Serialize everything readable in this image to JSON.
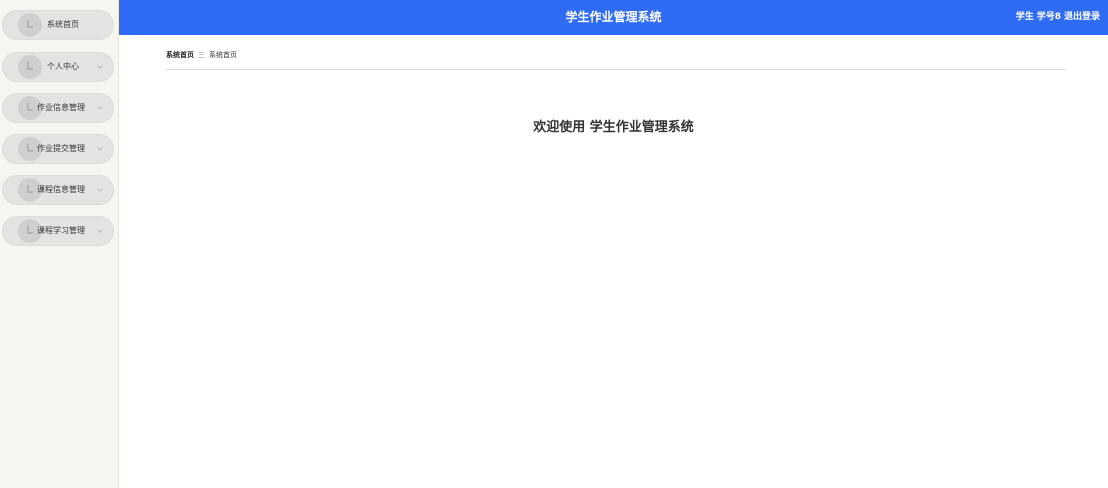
{
  "header": {
    "title": "学生作业管理系统",
    "user_role": "学生",
    "user_name": "学号8",
    "logout_label": "退出登录",
    "background_color": "#2f6cf6"
  },
  "sidebar": {
    "background_color": "#f6f5ef",
    "items": [
      {
        "label": "系统首页",
        "icon": "clock-icon",
        "has_submenu": false
      },
      {
        "label": "个人中心",
        "icon": "clock-icon",
        "has_submenu": true
      },
      {
        "label": "作业信息管理",
        "icon": "clock-icon",
        "has_submenu": true
      },
      {
        "label": "作业提交管理",
        "icon": "clock-icon",
        "has_submenu": true
      },
      {
        "label": "课程信息管理",
        "icon": "clock-icon",
        "has_submenu": true
      },
      {
        "label": "课程学习管理",
        "icon": "clock-icon",
        "has_submenu": true
      }
    ]
  },
  "breadcrumb": {
    "home": "系统首页",
    "separator": "三",
    "current": "系统首页"
  },
  "main": {
    "welcome_text": "欢迎使用 学生作业管理系统"
  }
}
